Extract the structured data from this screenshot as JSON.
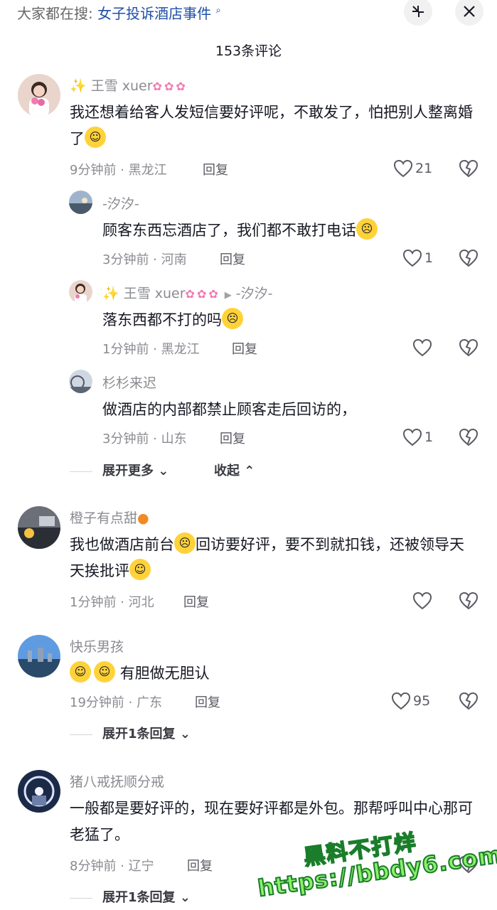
{
  "header": {
    "search_prefix": "大家都在搜:",
    "search_keyword": "女子投诉酒店事件",
    "comment_count": "153条评论"
  },
  "comments": [
    {
      "user": "王雪 xuer",
      "text": "我还想着给客人发短信要好评呢，不敢发了，怕把别人整离婚了",
      "time_location": "9分钟前 · 黑龙江",
      "reply_label": "回复",
      "likes": "21",
      "replies": [
        {
          "user": "-汐汐-",
          "text": "顾客东西忘酒店了，我们都不敢打电话",
          "time_location": "3分钟前 · 河南",
          "reply_label": "回复",
          "likes": "1"
        },
        {
          "user": "王雪 xuer",
          "reply_to": "-汐汐-",
          "text": "落东西都不打的吗",
          "time_location": "1分钟前 · 黑龙江",
          "reply_label": "回复",
          "likes": ""
        },
        {
          "user": "杉杉来迟",
          "text": "做酒店的内部都禁止顾客走后回访的，",
          "time_location": "3分钟前 · 山东",
          "reply_label": "回复",
          "likes": "1"
        }
      ],
      "expand_more": "展开更多",
      "collapse": "收起"
    },
    {
      "user": "橙子有点甜",
      "text_a": "我也做酒店前台",
      "text_b": "回访要好评，要不到就扣钱，还被领导天天挨批评",
      "time_location": "1分钟前 · 河北",
      "reply_label": "回复",
      "likes": ""
    },
    {
      "user": "快乐男孩",
      "text": "有胆做无胆认",
      "time_location": "19分钟前 · 广东",
      "reply_label": "回复",
      "likes": "95",
      "expand": "展开1条回复"
    },
    {
      "user": "猪八戒抚顺分戒",
      "text": "一般都是要好评的，现在要好评都是外包。那帮呼叫中心那可老猛了。",
      "time_location": "8分钟前 · 辽宁",
      "reply_label": "回复",
      "expand": "展开1条回复"
    }
  ],
  "watermark": {
    "line1": "黑料不打烊",
    "line2": "https://bbdy6.com"
  },
  "colors": {
    "like_icon": "#5a5b63",
    "meta": "#8a8b91",
    "keyword": "#1f4fa8",
    "watermark": "#8cf06a"
  }
}
